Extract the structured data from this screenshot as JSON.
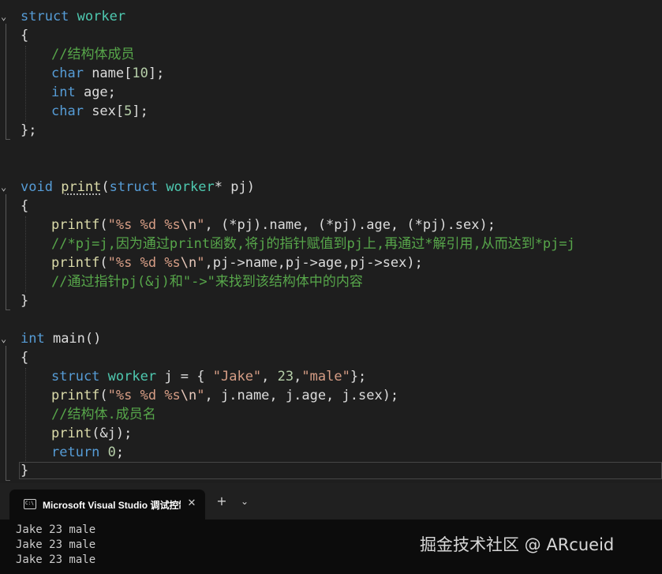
{
  "code": {
    "struct_header": {
      "kw": "struct",
      "name": "worker"
    },
    "open_brace": "{",
    "close_brace": "}",
    "struct_close": "};",
    "struct_comment": "//结构体成员",
    "field_char": "char",
    "field_int": "int",
    "field_name": " name",
    "field_name_size": "10",
    "field_age": " age;",
    "field_sex": " sex",
    "field_sex_size": "5",
    "lbracket": "[",
    "rbracket_semi": "];",
    "print_sig": {
      "void": "void",
      "fname": "print",
      "lparen": "(",
      "struct": "struct",
      "type": "worker",
      "param": "* pj",
      "rparen": ")"
    },
    "printf": "printf",
    "fmt": "\"%s %d %s",
    "esc": "\\n",
    "quote": "\"",
    "print_args1": ", (*pj).name, (*pj).age, (*pj).sex);",
    "comment1": "//*pj=j,因为通过print函数,将j的指针赋值到pj上,再通过*解引用,从而达到*pj=j",
    "print_args2": ",pj->name,pj->age,pj->sex);",
    "comment2": "//通过指针pj(&j)和\"->\"来找到该结构体中的内容",
    "main_sig": {
      "int": "int",
      "rest": " main()"
    },
    "main_decl": {
      "struct": "struct",
      "type": "worker",
      "var": " j = { ",
      "s1": "\"Jake\"",
      "sep1": ", ",
      "n1": "23",
      "sep2": ",",
      "s2": "\"male\"",
      "end": "};"
    },
    "main_printf_args": ", j.name, j.age, j.sex);",
    "comment3": "//结构体.成员名",
    "print_call": "print",
    "print_call_args": "(&j);",
    "return_kw": "return",
    "return_val": "0",
    "semi": ";"
  },
  "terminal": {
    "tab_icon_text": "C:\\",
    "tab_title": "Microsoft Visual Studio 调试控制台",
    "tab_close": "✕",
    "new_tab": "+",
    "dropdown": "⌄",
    "output": [
      "Jake 23 male",
      "Jake 23 male",
      "Jake 23 male"
    ]
  },
  "watermark": "掘金技术社区 @ ARcueid",
  "colors": {
    "keyword": "#569cd6",
    "type": "#4ec9b0",
    "function": "#dcdcaa",
    "string": "#d69d85",
    "number": "#b5cea8",
    "comment": "#57a64a",
    "background": "#1e1e1e",
    "terminal_bg": "#0c0c0c"
  }
}
